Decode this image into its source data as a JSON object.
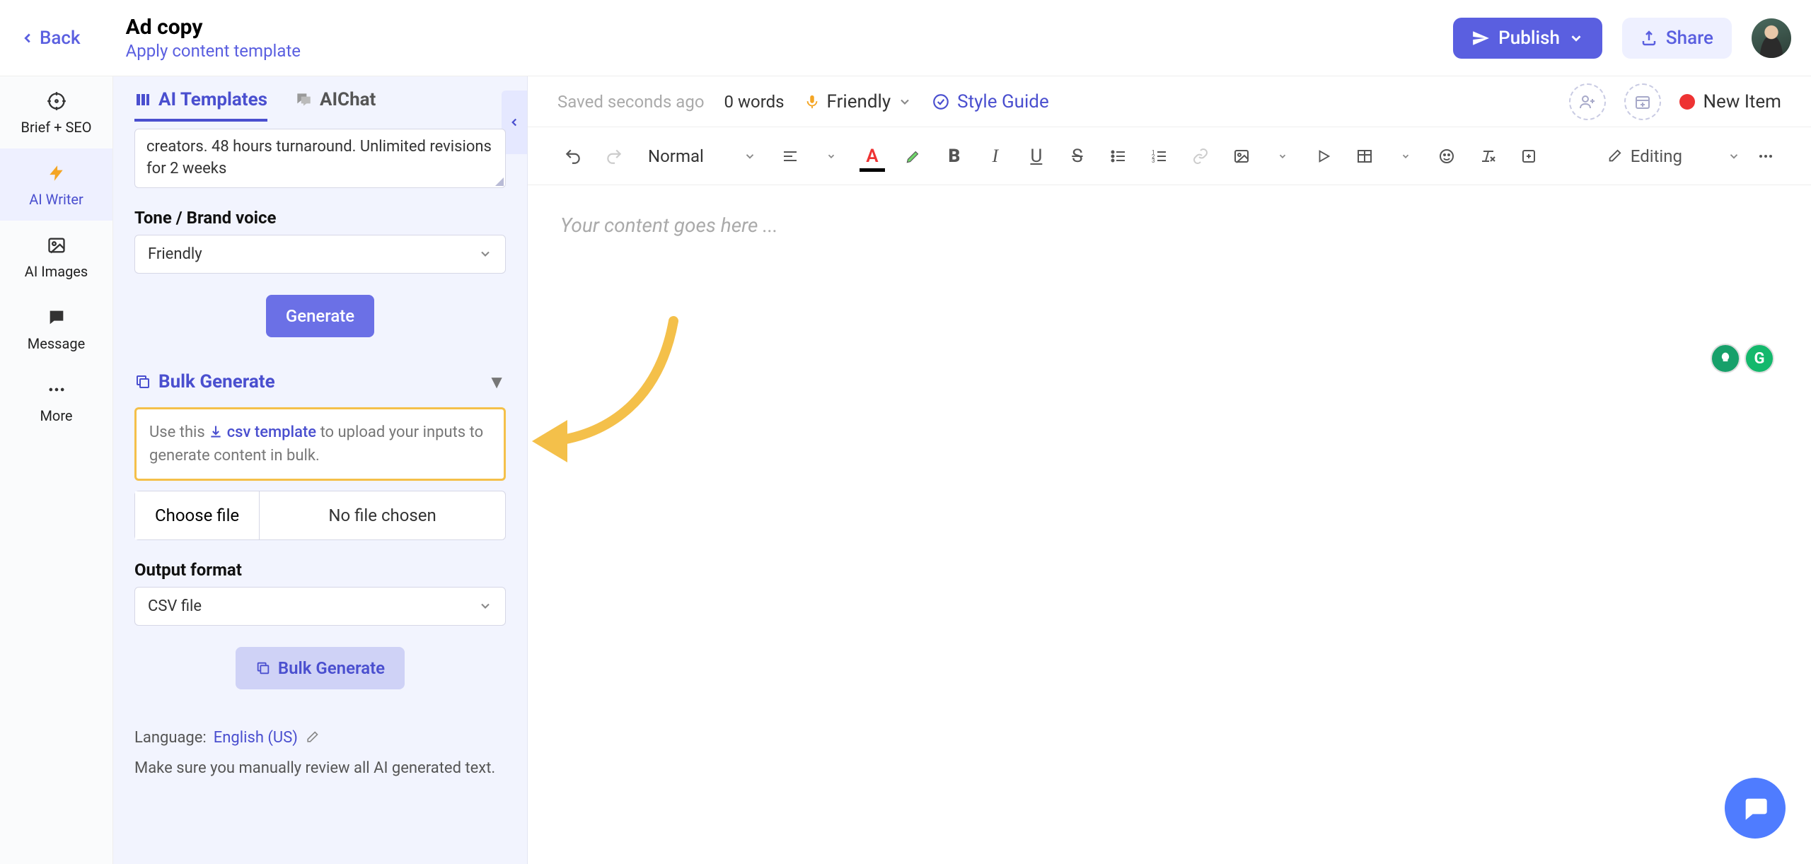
{
  "header": {
    "back": "Back",
    "title": "Ad copy",
    "apply_template": "Apply content template",
    "publish": "Publish",
    "share": "Share"
  },
  "nav": [
    {
      "label": "Brief + SEO",
      "icon": "target-icon",
      "active": false
    },
    {
      "label": "AI Writer",
      "icon": "bolt-icon",
      "active": true
    },
    {
      "label": "AI Images",
      "icon": "image-icon",
      "active": false
    },
    {
      "label": "Message",
      "icon": "chat-icon",
      "active": false
    },
    {
      "label": "More",
      "icon": "dots-icon",
      "active": false
    }
  ],
  "panel": {
    "tab_templates": "AI Templates",
    "tab_chat": "AIChat",
    "description_snippet": "creators. 48 hours turnaround. Unlimited revisions for 2 weeks",
    "tone_label": "Tone / Brand voice",
    "tone_value": "Friendly",
    "generate": "Generate",
    "bulk_header": "Bulk Generate",
    "bulk_hint_prefix": "Use this ",
    "bulk_hint_link": "csv template",
    "bulk_hint_suffix": " to upload your inputs to generate content in bulk.",
    "choose_file": "Choose file",
    "file_status": "No file chosen",
    "output_format_label": "Output format",
    "output_format_value": "CSV file",
    "bulk_generate_btn": "Bulk Generate",
    "language_label": "Language:",
    "language_value": "English (US)",
    "disclaimer": "Make sure you manually review all AI generated text."
  },
  "editor": {
    "saved": "Saved seconds ago",
    "word_count": "0 words",
    "tone": "Friendly",
    "style_guide": "Style Guide",
    "new_item": "New Item",
    "normal": "Normal",
    "editing": "Editing",
    "placeholder": "Your content goes here ..."
  },
  "colors": {
    "primary": "#5a5fe0",
    "accent": "#f4c04a"
  }
}
